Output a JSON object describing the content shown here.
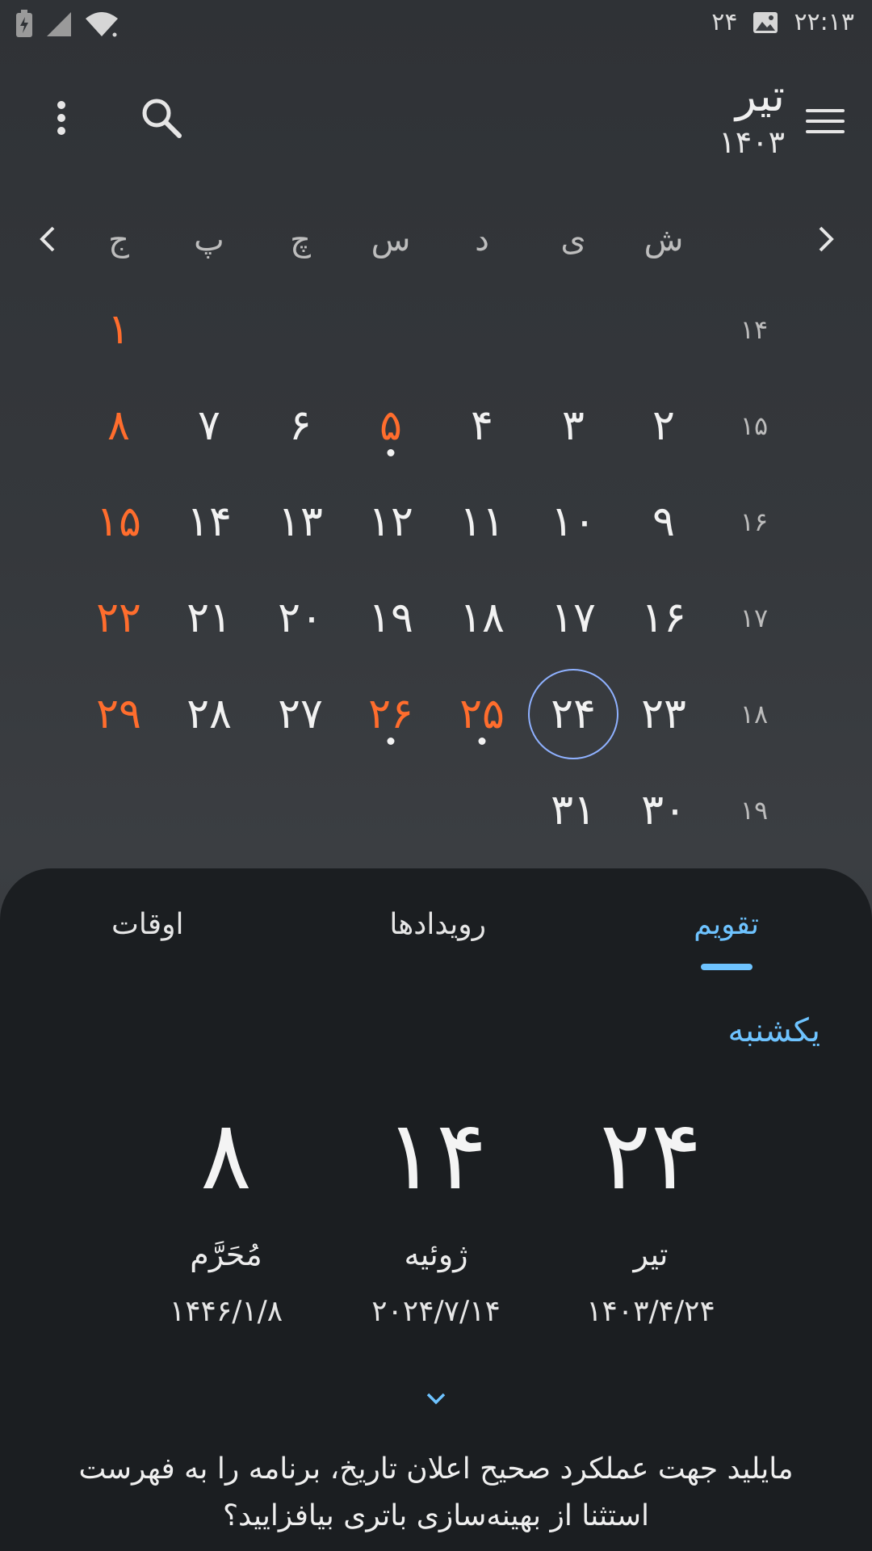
{
  "status_bar": {
    "time": "۲۲:۱۳",
    "notification_date": "۲۴"
  },
  "header": {
    "month": "تیر",
    "year": "۱۴۰۳"
  },
  "weekdays": [
    "ش",
    "ی",
    "د",
    "س",
    "چ",
    "پ",
    "ج"
  ],
  "weeks": [
    {
      "number": "۱۴",
      "days": [
        "",
        "",
        "",
        "",
        "",
        "",
        "۱"
      ]
    },
    {
      "number": "۱۵",
      "days": [
        "۲",
        "۳",
        "۴",
        "۵",
        "۶",
        "۷",
        "۸"
      ]
    },
    {
      "number": "۱۶",
      "days": [
        "۹",
        "۱۰",
        "۱۱",
        "۱۲",
        "۱۳",
        "۱۴",
        "۱۵"
      ]
    },
    {
      "number": "۱۷",
      "days": [
        "۱۶",
        "۱۷",
        "۱۸",
        "۱۹",
        "۲۰",
        "۲۱",
        "۲۲"
      ]
    },
    {
      "number": "۱۸",
      "days": [
        "۲۳",
        "۲۴",
        "۲۵",
        "۲۶",
        "۲۷",
        "۲۸",
        "۲۹"
      ]
    },
    {
      "number": "۱۹",
      "days": [
        "۳۰",
        "۳۱",
        "",
        "",
        "",
        "",
        ""
      ]
    }
  ],
  "holidays": [
    "۱",
    "۸",
    "۵",
    "۱۵",
    "۲۲",
    "۲۵",
    "۲۶",
    "۲۹"
  ],
  "event_dots": [
    "۵",
    "۲۵",
    "۲۶"
  ],
  "today": "۲۴",
  "tabs": {
    "calendar": "تقویم",
    "events": "رویدادها",
    "times": "اوقات"
  },
  "day_info": {
    "weekday": "یکشنبه",
    "persian": {
      "day": "۲۴",
      "month": "تیر",
      "date": "۱۴۰۳/۴/۲۴"
    },
    "gregorian": {
      "day": "۱۴",
      "month": "ژوئیه",
      "date": "۲۰۲۴/۷/۱۴"
    },
    "islamic": {
      "day": "۸",
      "month": "مُحَرَّم",
      "date": "۱۴۴۶/۱/۸"
    }
  },
  "notice": "مایلید جهت عملکرد صحیح اعلان تاریخ، برنامه را به فهرست استثنا از بهینه‌سازی باتری بیافزایید؟",
  "colors": {
    "accent": "#6ec3ff",
    "holiday": "#ff6d2d",
    "today_ring": "#8fb1ff",
    "sheet": "#1b1e21"
  }
}
